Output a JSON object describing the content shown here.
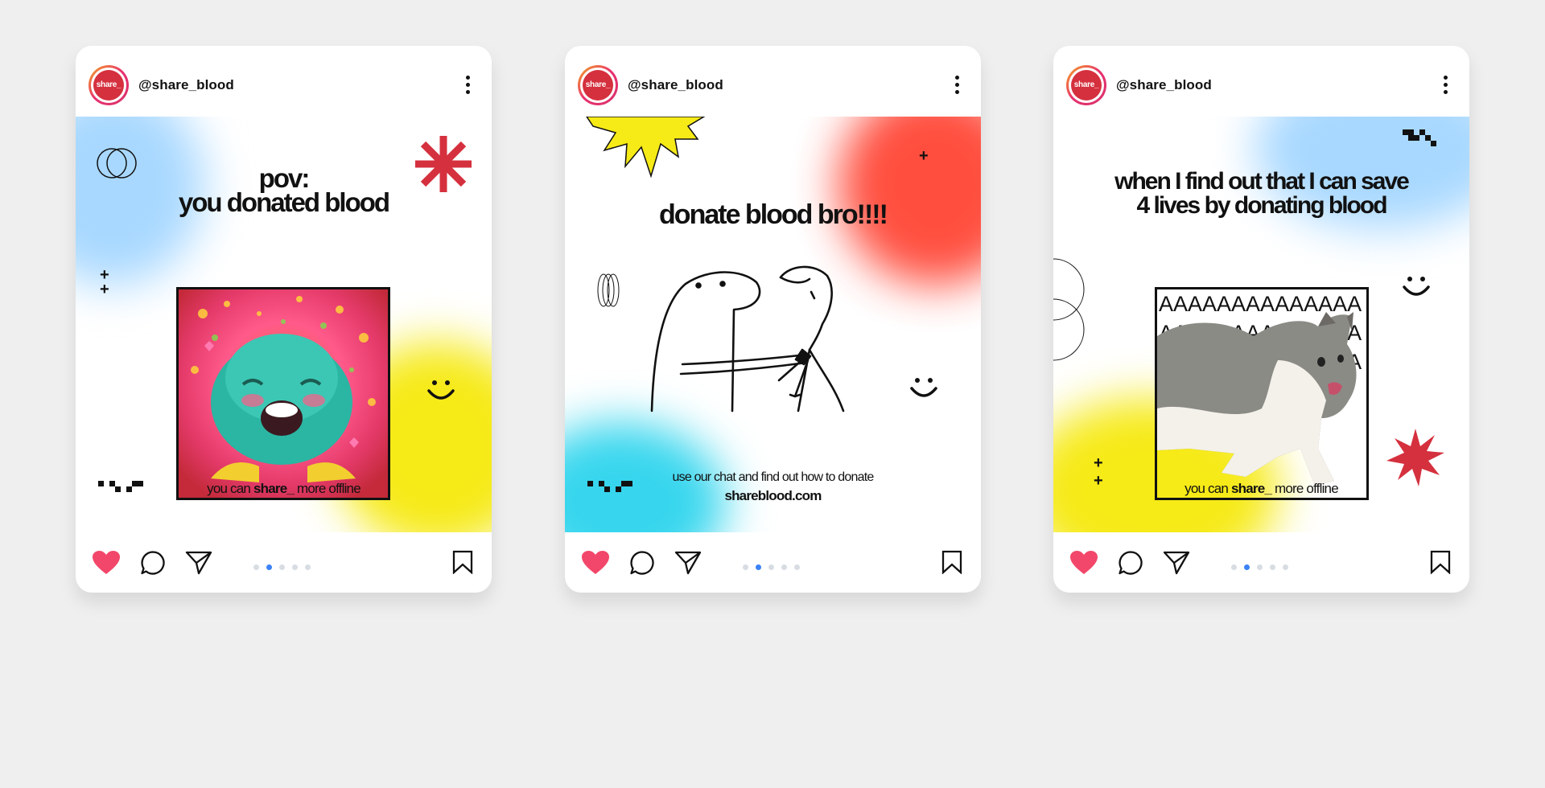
{
  "posts": [
    {
      "handle": "@share_blood",
      "avatar_text": "share_",
      "title_line1": "pov:",
      "title_line2": "you donated blood",
      "footer_prefix": "you can ",
      "footer_bold": "share_",
      "footer_suffix": " more offline",
      "image": "excited-troll-meme",
      "active_dot": 1,
      "dot_count": 5
    },
    {
      "handle": "@share_blood",
      "avatar_text": "share_",
      "title": "donate blood bro!!!!",
      "footer_line1": "use our chat and find out how to donate",
      "footer_link": "shareblood.com",
      "image": "stick-figure-doodle",
      "active_dot": 1,
      "dot_count": 5
    },
    {
      "handle": "@share_blood",
      "avatar_text": "share_",
      "title_line1": "when I find out that I can save",
      "title_line2": "4 lives by donating blood",
      "meme_text": "AAAAAAAAAAAAAAAAAAAAAAAAAAAAAAAAAAAAAAAAAAAAAAAAAA",
      "footer_prefix": "you can ",
      "footer_bold": "share_",
      "footer_suffix": " more offline",
      "image": "screaming-cat-meme",
      "active_dot": 1,
      "dot_count": 5
    }
  ],
  "icons": {
    "like": "heart-icon",
    "comment": "comment-icon",
    "share": "send-icon",
    "save": "bookmark-icon",
    "more": "more-icon"
  },
  "colors": {
    "background": "#efefef",
    "brand_red": "#d5303e",
    "like_red": "#f2476a",
    "dot_active": "#3b82f6",
    "dot_inactive": "#d8dde3"
  }
}
